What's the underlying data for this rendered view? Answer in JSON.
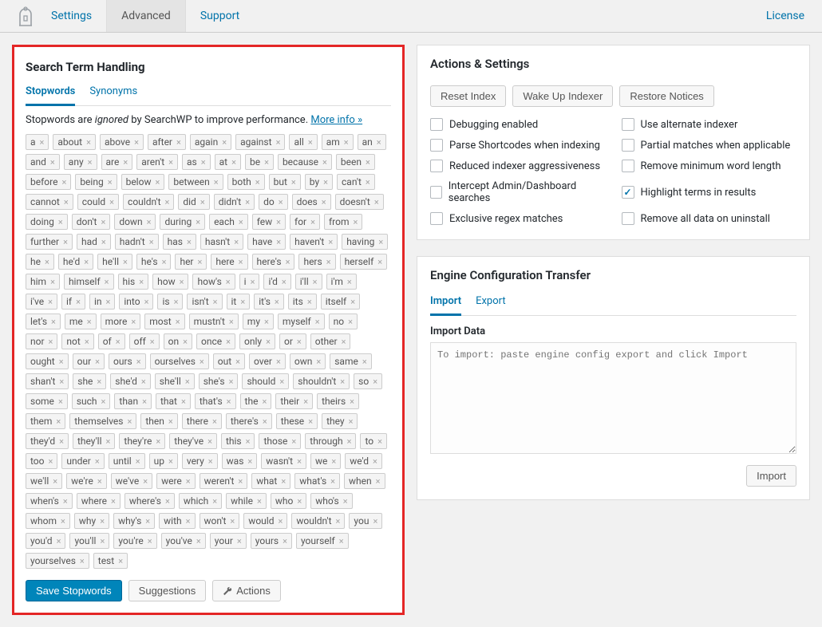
{
  "header": {
    "tabs": {
      "settings": "Settings",
      "advanced": "Advanced",
      "support": "Support"
    },
    "license": "License"
  },
  "search_handling": {
    "title": "Search Term Handling",
    "tabs": {
      "stopwords": "Stopwords",
      "synonyms": "Synonyms"
    },
    "desc_prefix": "Stopwords are ",
    "desc_em": "ignored",
    "desc_suffix": " by SearchWP to improve performance. ",
    "desc_link": "More info »",
    "stopwords": [
      "a",
      "about",
      "above",
      "after",
      "again",
      "against",
      "all",
      "am",
      "an",
      "and",
      "any",
      "are",
      "aren't",
      "as",
      "at",
      "be",
      "because",
      "been",
      "before",
      "being",
      "below",
      "between",
      "both",
      "but",
      "by",
      "can't",
      "cannot",
      "could",
      "couldn't",
      "did",
      "didn't",
      "do",
      "does",
      "doesn't",
      "doing",
      "don't",
      "down",
      "during",
      "each",
      "few",
      "for",
      "from",
      "further",
      "had",
      "hadn't",
      "has",
      "hasn't",
      "have",
      "haven't",
      "having",
      "he",
      "he'd",
      "he'll",
      "he's",
      "her",
      "here",
      "here's",
      "hers",
      "herself",
      "him",
      "himself",
      "his",
      "how",
      "how's",
      "i",
      "i'd",
      "i'll",
      "i'm",
      "i've",
      "if",
      "in",
      "into",
      "is",
      "isn't",
      "it",
      "it's",
      "its",
      "itself",
      "let's",
      "me",
      "more",
      "most",
      "mustn't",
      "my",
      "myself",
      "no",
      "nor",
      "not",
      "of",
      "off",
      "on",
      "once",
      "only",
      "or",
      "other",
      "ought",
      "our",
      "ours",
      "ourselves",
      "out",
      "over",
      "own",
      "same",
      "shan't",
      "she",
      "she'd",
      "she'll",
      "she's",
      "should",
      "shouldn't",
      "so",
      "some",
      "such",
      "than",
      "that",
      "that's",
      "the",
      "their",
      "theirs",
      "them",
      "themselves",
      "then",
      "there",
      "there's",
      "these",
      "they",
      "they'd",
      "they'll",
      "they're",
      "they've",
      "this",
      "those",
      "through",
      "to",
      "too",
      "under",
      "until",
      "up",
      "very",
      "was",
      "wasn't",
      "we",
      "we'd",
      "we'll",
      "we're",
      "we've",
      "were",
      "weren't",
      "what",
      "what's",
      "when",
      "when's",
      "where",
      "where's",
      "which",
      "while",
      "who",
      "who's",
      "whom",
      "why",
      "why's",
      "with",
      "won't",
      "would",
      "wouldn't",
      "you",
      "you'd",
      "you'll",
      "you're",
      "you've",
      "your",
      "yours",
      "yourself",
      "yourselves",
      "test"
    ],
    "save_btn": "Save Stopwords",
    "suggestions_btn": "Suggestions",
    "actions_btn": "Actions"
  },
  "actions": {
    "title": "Actions & Settings",
    "buttons": {
      "reset": "Reset Index",
      "wake": "Wake Up Indexer",
      "restore": "Restore Notices"
    },
    "checks": [
      {
        "label": "Debugging enabled",
        "checked": false
      },
      {
        "label": "Use alternate indexer",
        "checked": false
      },
      {
        "label": "Parse Shortcodes when indexing",
        "checked": false
      },
      {
        "label": "Partial matches when applicable",
        "checked": false
      },
      {
        "label": "Reduced indexer aggressiveness",
        "checked": false
      },
      {
        "label": "Remove minimum word length",
        "checked": false
      },
      {
        "label": "Intercept Admin/Dashboard searches",
        "checked": false
      },
      {
        "label": "Highlight terms in results",
        "checked": true
      },
      {
        "label": "Exclusive regex matches",
        "checked": false
      },
      {
        "label": "Remove all data on uninstall",
        "checked": false
      }
    ]
  },
  "engine": {
    "title": "Engine Configuration Transfer",
    "tabs": {
      "import": "Import",
      "export": "Export"
    },
    "import_label": "Import Data",
    "import_placeholder": "To import: paste engine config export and click Import",
    "import_btn": "Import"
  }
}
